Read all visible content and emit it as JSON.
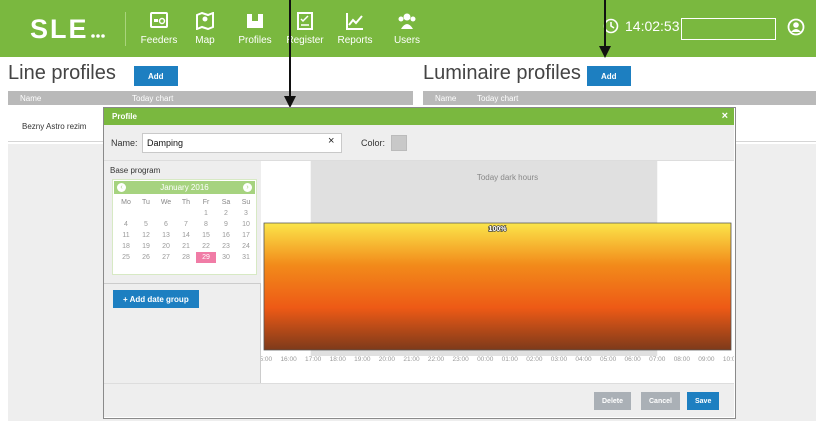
{
  "nav": {
    "items": [
      {
        "label": "Feeders",
        "icon": "feeders-icon"
      },
      {
        "label": "Map",
        "icon": "map-icon"
      },
      {
        "label": "Profiles",
        "icon": "profiles-icon"
      },
      {
        "label": "Register",
        "icon": "register-icon"
      },
      {
        "label": "Reports",
        "icon": "reports-icon"
      },
      {
        "label": "Users",
        "icon": "users-icon"
      }
    ],
    "time": "14:02:53",
    "search_value": ""
  },
  "line_profiles": {
    "title": "Line profiles",
    "add_label": "Add",
    "columns": [
      "Name",
      "Today chart"
    ],
    "rows": [
      {
        "name": "Bezny Astro rezim"
      }
    ]
  },
  "luminaire_profiles": {
    "title": "Luminaire profiles",
    "add_label": "Add",
    "columns": [
      "Name",
      "Today chart"
    ]
  },
  "modal": {
    "title": "Profile",
    "close_glyph": "×",
    "name_label": "Name:",
    "name_value": "Damping",
    "clear_glyph": "×",
    "color_label": "Color:",
    "color_value": "#c8c8c8",
    "base_program_label": "Base program",
    "calendar": {
      "month": "January 2016",
      "prev": "‹",
      "next": "›",
      "weekdays": [
        "Mo",
        "Tu",
        "We",
        "Th",
        "Fr",
        "Sa",
        "Su"
      ],
      "weeks": [
        [
          "",
          "",
          "",
          "",
          "1",
          "2",
          "3"
        ],
        [
          "4",
          "5",
          "6",
          "7",
          "8",
          "9",
          "10"
        ],
        [
          "11",
          "12",
          "13",
          "14",
          "15",
          "16",
          "17"
        ],
        [
          "18",
          "19",
          "20",
          "21",
          "22",
          "23",
          "24"
        ],
        [
          "25",
          "26",
          "27",
          "28",
          "29",
          "30",
          "31"
        ]
      ],
      "selected": "29"
    },
    "add_date_group_label": "+ Add date group",
    "buttons": {
      "delete": "Delete",
      "cancel": "Cancel",
      "save": "Save"
    },
    "colors": {
      "delete": "#aab0b6",
      "cancel": "#aab0b6",
      "save": "#1d7fc1"
    }
  },
  "chart_data": {
    "type": "area",
    "title": "Today dark hours",
    "x": [
      "15:00",
      "16:00",
      "17:00",
      "18:00",
      "19:00",
      "20:00",
      "21:00",
      "22:00",
      "23:00",
      "00:00",
      "01:00",
      "02:00",
      "03:00",
      "04:00",
      "05:00",
      "06:00",
      "07:00",
      "08:00",
      "09:00",
      "10:00"
    ],
    "series": [
      {
        "values": [
          100,
          100,
          100,
          100,
          100,
          100,
          100,
          100,
          100,
          100,
          100,
          100,
          100,
          100,
          100,
          100,
          100,
          100,
          100,
          100
        ]
      }
    ],
    "value_label": "100%",
    "ylim": [
      0,
      100
    ],
    "dark_start": "17:00",
    "dark_end": "07:00",
    "gradient": [
      "#fbe54a",
      "#f28a1a",
      "#ee5a16",
      "#7d3a1a"
    ],
    "dark_shade": "#e0e0e0"
  }
}
